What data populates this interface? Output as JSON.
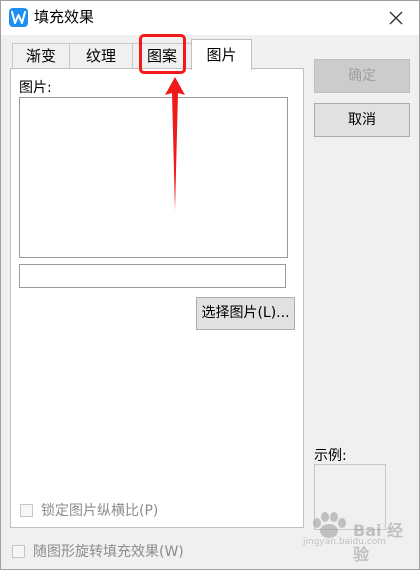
{
  "window": {
    "title": "填充效果",
    "app_icon_letter": "W"
  },
  "tabs": [
    {
      "label": "渐变",
      "active": false
    },
    {
      "label": "纹理",
      "active": false
    },
    {
      "label": "图案",
      "active": false
    },
    {
      "label": "图片",
      "active": true
    }
  ],
  "picture_panel": {
    "picture_label": "图片:",
    "path_value": "",
    "select_button_label": "选择图片(L)...",
    "lock_aspect_label": "锁定图片纵横比(P)"
  },
  "rotate_with_shape_label": "随图形旋转填充效果(W)",
  "buttons": {
    "ok_label": "确定",
    "cancel_label": "取消"
  },
  "sample_label": "示例:",
  "watermark": {
    "main": "Bai 经验",
    "sub": "jingyan.baidu.com"
  },
  "colors": {
    "accent_blue": "#1f8ef1",
    "annotation_red": "#f01a1a"
  }
}
